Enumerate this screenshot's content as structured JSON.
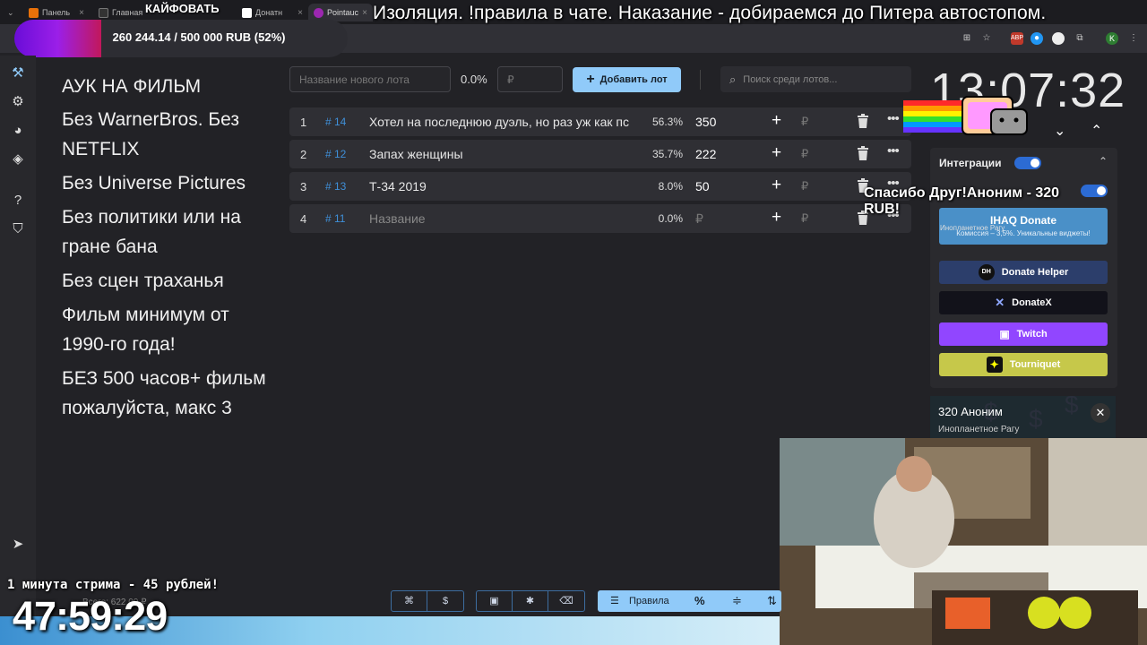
{
  "browser": {
    "tabs": [
      {
        "label": "Панель",
        "color": "#e8710a"
      },
      {
        "label": "Главная",
        "color": "#333333"
      },
      {
        "label": "Донатн",
        "color": "#ffffff"
      },
      {
        "label": "Pointauc",
        "color": "#9c27b0"
      }
    ]
  },
  "overlay": {
    "marquee": "Изоляция. !правила в чате. Наказание - добираемся до Питера автостопом.",
    "kaif_label": "КАЙФОВАТЬ",
    "goal_text": "260 244.14 / 500 000 RUB (52%)",
    "goal_fraction": 0.52,
    "pay_rate": "1 минута стрима - 45 рублей!",
    "timer": "47:59:29",
    "total_label": "Всего: 622.00 ₽"
  },
  "rules": {
    "title": "АУК НА ФИЛЬМ",
    "items": [
      "Без WarnerBros. Без NETFLIX",
      "Без Universe Pictures",
      "Без политики или на гране бана",
      "Без сцен траханья",
      "Фильм минимум от 1990-го года!",
      "БЕЗ 500 часов+ фильм пожалуйста, макс 3"
    ]
  },
  "toolbar": {
    "new_lot_placeholder": "Название нового лота",
    "total_percent": "0.0%",
    "amount_placeholder": "₽",
    "add_lot_label": "Добавить лот",
    "search_placeholder": "Поиск среди лотов..."
  },
  "lots": [
    {
      "num": "1",
      "id": "# 14",
      "name": "Хотел на последнюю дуэль, но раз уж как пс",
      "percent": "56.3%",
      "amount": "350",
      "currency": "₽"
    },
    {
      "num": "2",
      "id": "# 12",
      "name": "Запах женщины",
      "percent": "35.7%",
      "amount": "222",
      "currency": "₽"
    },
    {
      "num": "3",
      "id": "# 13",
      "name": "Т-34 2019",
      "percent": "8.0%",
      "amount": "50",
      "currency": "₽"
    },
    {
      "num": "4",
      "id": "# 11",
      "name": "Название",
      "percent": "0.0%",
      "amount": "₽",
      "currency": "₽"
    }
  ],
  "clock": "13:07:32",
  "integrations": {
    "title": "Интеграции",
    "thanks": "Спасибо Друг!Аноним - 320 RUB!",
    "thanks_sub": "Инопланетное Рагу",
    "ihaq_title": "IHAQ Donate",
    "ihaq_sub": "Комиссия – 3,5%. Уникальные виджеты!",
    "services": [
      "Donate Helper",
      "DonateX",
      "Twitch",
      "Tourniquet"
    ],
    "colors": {
      "donate_helper": "#2c3e6b",
      "donatex": "#12121a",
      "twitch": "#9146ff",
      "tourniquet": "#c6c84a"
    }
  },
  "donation": {
    "amount_line": "320 Аноним",
    "from": "Инопланетное Рагу"
  },
  "bottom": {
    "rules_label": "Правила"
  },
  "accent": "#90caf9"
}
